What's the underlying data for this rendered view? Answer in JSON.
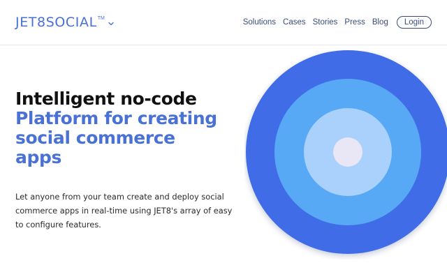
{
  "brand": {
    "name": "JET8SOCIAL",
    "trademark": "TM"
  },
  "nav": {
    "items": [
      "Solutions",
      "Cases",
      "Stories",
      "Press",
      "Blog"
    ],
    "login_label": "Login"
  },
  "hero": {
    "line1": "Intelligent no-code",
    "line2": "Platform for creating",
    "line3": "social commerce",
    "line4": "apps",
    "subtitle": "Let anyone from your team create and deploy social commerce apps in real-time using JET8's array of easy to configure features."
  },
  "colors": {
    "brand_blue": "#4a72d4",
    "ring_outer": "#3f6ce8",
    "ring_middle": "#57a8f5",
    "ring_inner": "#a9d1fb",
    "center": "#e9e6f6"
  }
}
